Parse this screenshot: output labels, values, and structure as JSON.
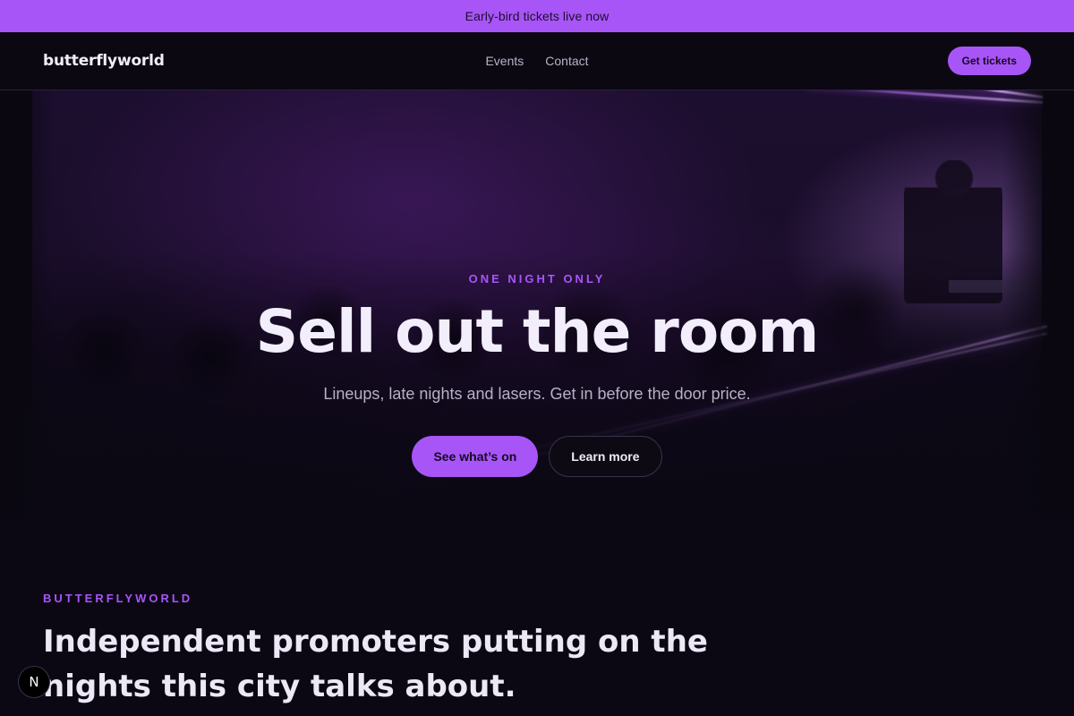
{
  "announcement": {
    "text": "Early-bird tickets live now"
  },
  "header": {
    "logo": "butterflyworld",
    "nav": [
      {
        "label": "Events"
      },
      {
        "label": "Contact"
      }
    ],
    "cta_label": "Get tickets"
  },
  "hero": {
    "eyebrow": "ONE NIGHT ONLY",
    "title": "Sell out the room",
    "subtitle": "Lineups, late nights and lasers. Get in before the door price.",
    "primary_button": "See what’s on",
    "secondary_button": "Learn more"
  },
  "about": {
    "eyebrow": "BUTTERFLYWORLD",
    "title": "Independent promoters putting on the nights this city talks about."
  },
  "floating_badge": {
    "label": "N",
    "icon": "next-logo-icon"
  },
  "colors": {
    "accent": "#a855f7",
    "background": "#0b0814",
    "text": "#ece8f6"
  }
}
